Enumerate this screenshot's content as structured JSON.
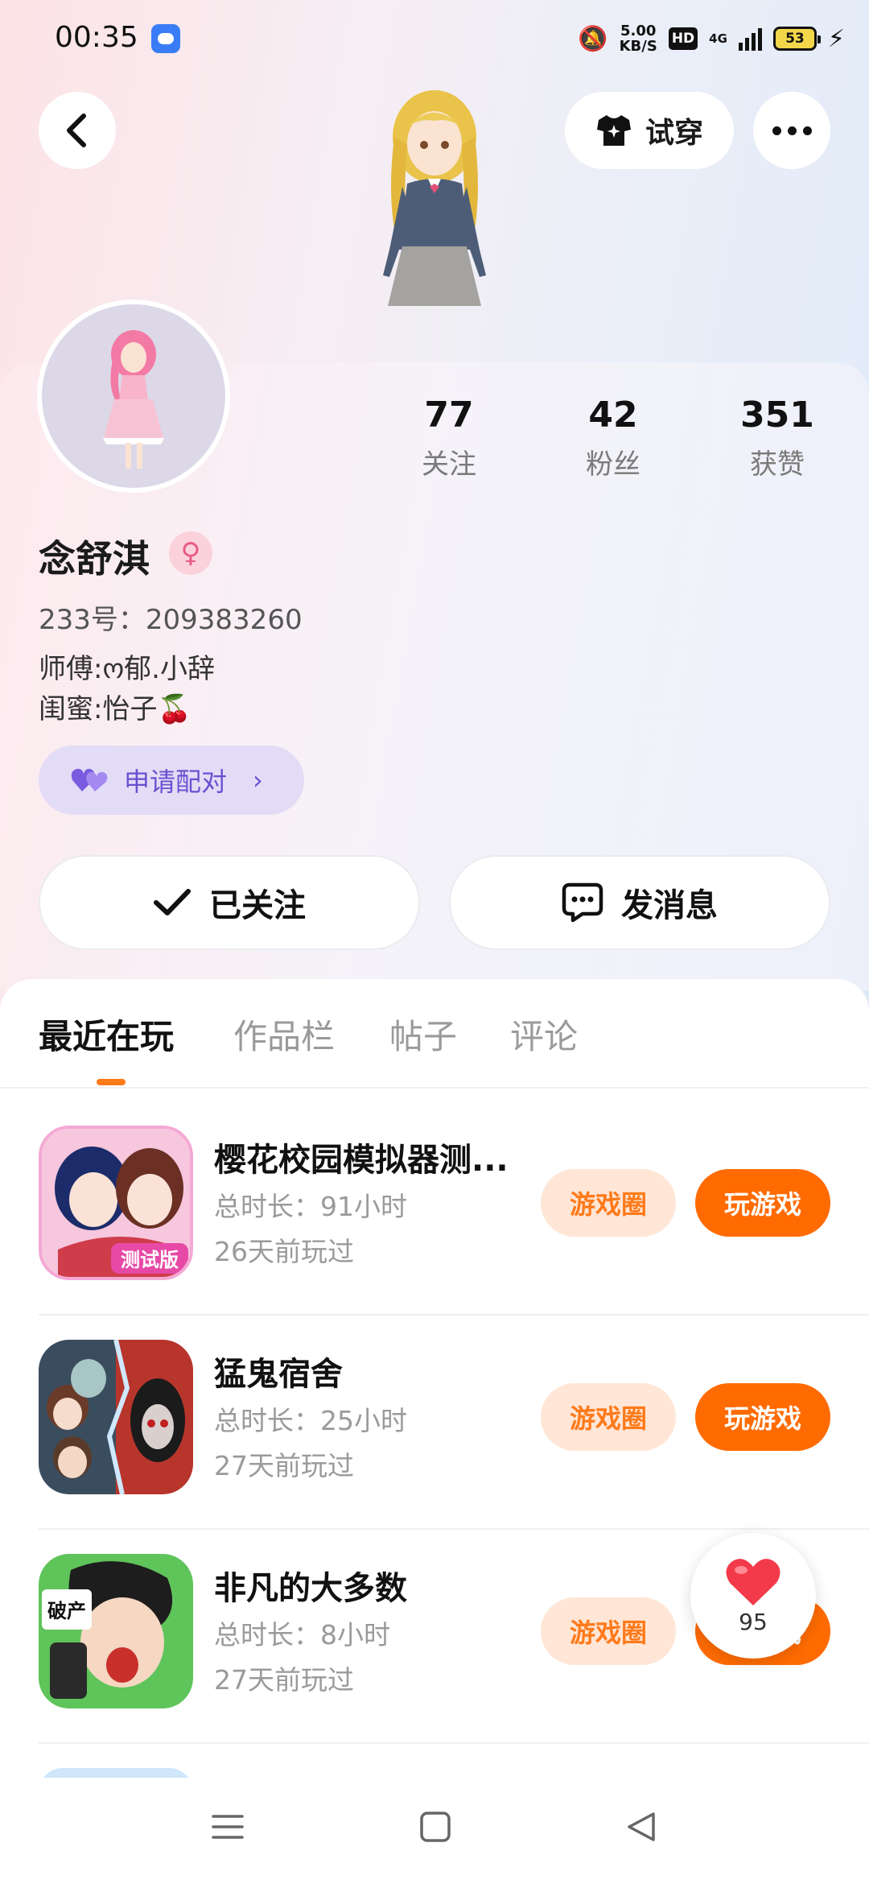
{
  "status_bar": {
    "time": "00:35",
    "speed_value": "5.00",
    "speed_unit": "KB/S",
    "hd": "HD",
    "network": "4G",
    "battery": "53"
  },
  "header": {
    "try_on_label": "试穿"
  },
  "profile": {
    "stats": [
      {
        "value": "77",
        "label": "关注"
      },
      {
        "value": "42",
        "label": "粉丝"
      },
      {
        "value": "351",
        "label": "获赞"
      }
    ],
    "name": "念舒淇",
    "id_line": "233号：209383260",
    "bio_lines": [
      "师傅:ო郁.小辞",
      "闺蜜:怡子🍒"
    ],
    "pair_label": "申请配对",
    "followed_label": "已关注",
    "message_label": "发消息"
  },
  "tabs": [
    "最近在玩",
    "作品栏",
    "帖子",
    "评论"
  ],
  "games": [
    {
      "title": "樱花校园模拟器测...",
      "duration": "总时长：91小时",
      "last_played": "26天前玩过",
      "circle_label": "游戏圈",
      "play_label": "玩游戏",
      "badge": "测试版"
    },
    {
      "title": "猛鬼宿舍",
      "duration": "总时长：25小时",
      "last_played": "27天前玩过",
      "circle_label": "游戏圈",
      "play_label": "玩游戏"
    },
    {
      "title": "非凡的大多数",
      "duration": "总时长：8小时",
      "last_played": "27天前玩过",
      "circle_label": "游戏圈",
      "play_label": "玩游戏",
      "badge": "破产"
    }
  ],
  "like_float": {
    "count": "95"
  },
  "colors": {
    "accent": "#ff6b00",
    "accent_light": "#ffe6d6",
    "pair": "#6b4fd1"
  }
}
